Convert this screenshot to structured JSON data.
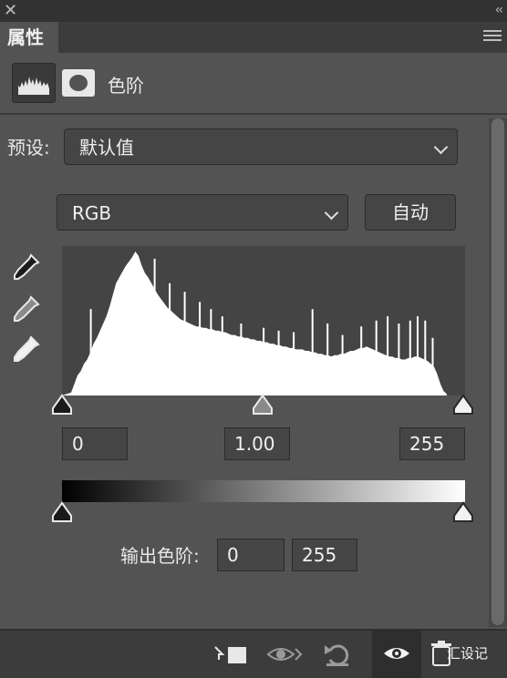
{
  "panel": {
    "tab_label": "属性",
    "title": "色阶"
  },
  "preset": {
    "label": "预设:",
    "value": "默认值"
  },
  "channel": {
    "value": "RGB",
    "auto_button": "自动"
  },
  "input_levels": {
    "black": "0",
    "gamma": "1.00",
    "white": "255"
  },
  "output_levels": {
    "label": "输出色阶:",
    "black": "0",
    "white": "255"
  },
  "histogram": {
    "channel": "RGB",
    "bins_relative_height": [
      0.02,
      0.08,
      0.14,
      0.17,
      0.22,
      0.25,
      0.3,
      0.36,
      0.4,
      0.45,
      0.5,
      0.55,
      0.62,
      0.7,
      0.78,
      0.82,
      0.86,
      0.9,
      0.93,
      0.96,
      1.0,
      0.97,
      0.9,
      0.85,
      0.82,
      0.78,
      0.74,
      0.7,
      0.67,
      0.64,
      0.61,
      0.59,
      0.57,
      0.55,
      0.53,
      0.52,
      0.51,
      0.5,
      0.49,
      0.48,
      0.48,
      0.47,
      0.47,
      0.46,
      0.46,
      0.45,
      0.45,
      0.44,
      0.44,
      0.43,
      0.42,
      0.42,
      0.41,
      0.41,
      0.4,
      0.4,
      0.39,
      0.39,
      0.38,
      0.38,
      0.37,
      0.37,
      0.36,
      0.36,
      0.35,
      0.35,
      0.34,
      0.34,
      0.33,
      0.33,
      0.32,
      0.32,
      0.32,
      0.31,
      0.31,
      0.3,
      0.3,
      0.29,
      0.29,
      0.28,
      0.28,
      0.27,
      0.28,
      0.28,
      0.29,
      0.29,
      0.3,
      0.31,
      0.31,
      0.32,
      0.33,
      0.33,
      0.34,
      0.33,
      0.32,
      0.31,
      0.3,
      0.29,
      0.28,
      0.27,
      0.27,
      0.26,
      0.26,
      0.25,
      0.25,
      0.26,
      0.26,
      0.27,
      0.27,
      0.26,
      0.25,
      0.24,
      0.22,
      0.2,
      0.15,
      0.08,
      0.03,
      0.01
    ],
    "spikes": [
      {
        "pos": 0.05,
        "h": 0.6
      },
      {
        "pos": 0.14,
        "h": 0.8
      },
      {
        "pos": 0.17,
        "h": 0.9
      },
      {
        "pos": 0.22,
        "h": 0.95
      },
      {
        "pos": 0.26,
        "h": 0.78
      },
      {
        "pos": 0.3,
        "h": 0.72
      },
      {
        "pos": 0.34,
        "h": 0.65
      },
      {
        "pos": 0.37,
        "h": 0.6
      },
      {
        "pos": 0.4,
        "h": 0.55
      },
      {
        "pos": 0.45,
        "h": 0.5
      },
      {
        "pos": 0.51,
        "h": 0.47
      },
      {
        "pos": 0.55,
        "h": 0.45
      },
      {
        "pos": 0.59,
        "h": 0.44
      },
      {
        "pos": 0.64,
        "h": 0.6
      },
      {
        "pos": 0.68,
        "h": 0.5
      },
      {
        "pos": 0.72,
        "h": 0.42
      },
      {
        "pos": 0.77,
        "h": 0.48
      },
      {
        "pos": 0.81,
        "h": 0.52
      },
      {
        "pos": 0.84,
        "h": 0.55
      },
      {
        "pos": 0.87,
        "h": 0.5
      },
      {
        "pos": 0.9,
        "h": 0.52
      },
      {
        "pos": 0.92,
        "h": 0.55
      },
      {
        "pos": 0.94,
        "h": 0.52
      },
      {
        "pos": 0.96,
        "h": 0.4
      }
    ]
  },
  "sliders": {
    "input_black": 0,
    "input_gamma": 0.5,
    "input_white": 1,
    "output_black": 0,
    "output_white": 1
  },
  "footer": {
    "watermark": "汇设记"
  },
  "icons": [
    "close-icon",
    "collapse-icon",
    "panel-menu-icon",
    "levels-adjustment-icon",
    "mask-icon",
    "black-point-eyedropper-icon",
    "gray-point-eyedropper-icon",
    "white-point-eyedropper-icon",
    "clip-to-layer-icon",
    "view-previous-state-icon",
    "reset-icon",
    "visibility-eye-icon",
    "delete-icon"
  ]
}
